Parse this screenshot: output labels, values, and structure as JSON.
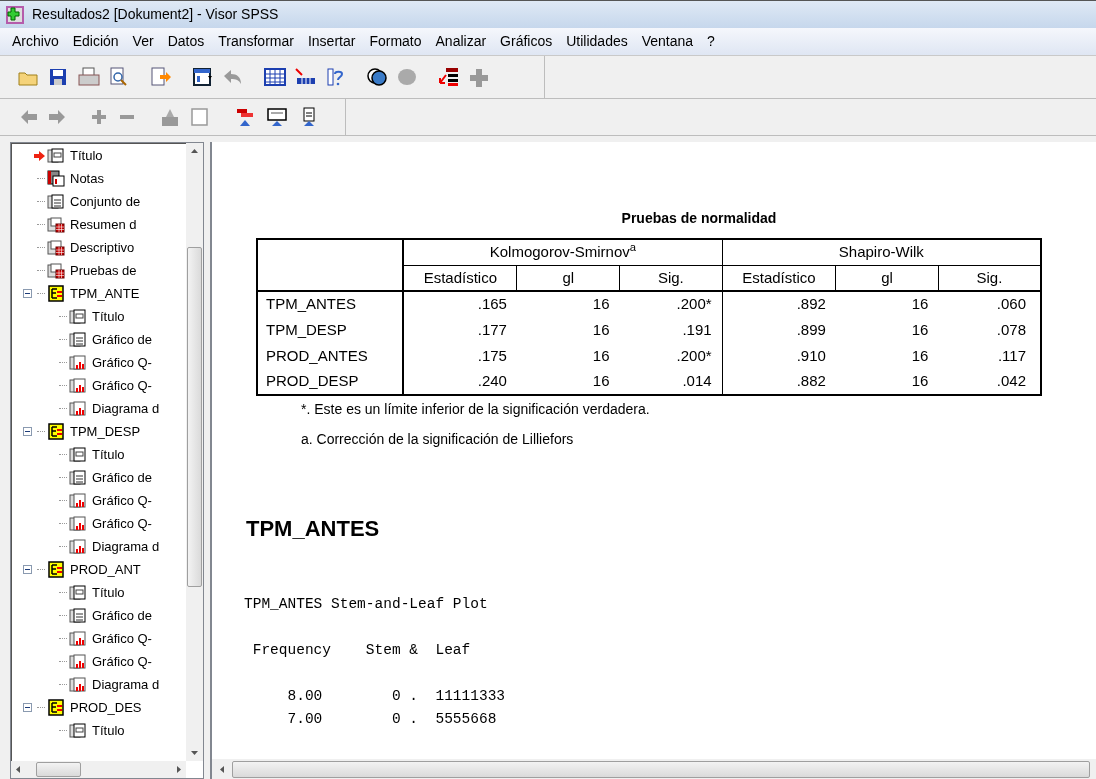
{
  "window": {
    "title": "Resultados2 [Dokument2] - Visor SPSS"
  },
  "menu": [
    "Archivo",
    "Edición",
    "Ver",
    "Datos",
    "Transformar",
    "Insertar",
    "Formato",
    "Analizar",
    "Gráficos",
    "Utilidades",
    "Ventana",
    "?"
  ],
  "tree": [
    {
      "kind": "title",
      "label": "Título",
      "current": true
    },
    {
      "kind": "notes",
      "label": "Notas",
      "current": false
    },
    {
      "kind": "text",
      "label": "Conjunto de",
      "current": false
    },
    {
      "kind": "table",
      "label": "Resumen d",
      "current": false
    },
    {
      "kind": "table",
      "label": "Descriptivo",
      "current": false
    },
    {
      "kind": "table",
      "label": "Pruebas de",
      "current": false
    },
    {
      "kind": "folder",
      "label": "TPM_ANTE",
      "current": false,
      "expanded": true,
      "children": [
        {
          "kind": "title",
          "label": "Título",
          "current": false
        },
        {
          "kind": "text",
          "label": "Gráfico de",
          "current": false
        },
        {
          "kind": "chart",
          "label": "Gráfico Q-",
          "current": false
        },
        {
          "kind": "chart",
          "label": "Gráfico Q-",
          "current": false
        },
        {
          "kind": "chart",
          "label": "Diagrama d",
          "current": false
        }
      ]
    },
    {
      "kind": "folder",
      "label": "TPM_DESP",
      "current": false,
      "expanded": true,
      "children": [
        {
          "kind": "title",
          "label": "Título",
          "current": false
        },
        {
          "kind": "text",
          "label": "Gráfico de",
          "current": false
        },
        {
          "kind": "chart",
          "label": "Gráfico Q-",
          "current": false
        },
        {
          "kind": "chart",
          "label": "Gráfico Q-",
          "current": false
        },
        {
          "kind": "chart",
          "label": "Diagrama d",
          "current": false
        }
      ]
    },
    {
      "kind": "folder",
      "label": "PROD_ANT",
      "current": false,
      "expanded": true,
      "children": [
        {
          "kind": "title",
          "label": "Título",
          "current": false
        },
        {
          "kind": "text",
          "label": "Gráfico de",
          "current": false
        },
        {
          "kind": "chart",
          "label": "Gráfico Q-",
          "current": false
        },
        {
          "kind": "chart",
          "label": "Gráfico Q-",
          "current": false
        },
        {
          "kind": "chart",
          "label": "Diagrama d",
          "current": false
        }
      ]
    },
    {
      "kind": "folder",
      "label": "PROD_DES",
      "current": false,
      "expanded": true,
      "children": [
        {
          "kind": "title",
          "label": "Título",
          "current": false
        }
      ]
    }
  ],
  "table": {
    "title": "Pruebas de normalidad",
    "groups": [
      {
        "label": "Kolmogorov-Smirnov$^{a}$"
      },
      {
        "label": "Shapiro-Wilk"
      }
    ],
    "columns": [
      "Estadístico",
      "gl",
      "Sig.",
      "Estadístico",
      "gl",
      "Sig."
    ],
    "rows": [
      {
        "label": "TPM_ANTES",
        "cells": [
          ".165",
          "16",
          ".200*",
          ".892",
          "16",
          ".060"
        ]
      },
      {
        "label": "TPM_DESP",
        "cells": [
          ".177",
          "16",
          ".191",
          ".899",
          "16",
          ".078"
        ]
      },
      {
        "label": "PROD_ANTES",
        "cells": [
          ".175",
          "16",
          ".200*",
          ".910",
          "16",
          ".117"
        ]
      },
      {
        "label": "PROD_DESP",
        "cells": [
          ".240",
          "16",
          ".014",
          ".882",
          "16",
          ".042"
        ]
      }
    ],
    "footnotes": [
      "*. Este es un límite inferior de la significación verdadera.",
      "a. Corrección de la significación de Lilliefors"
    ]
  },
  "heading": "TPM_ANTES",
  "plot": {
    "title": "TPM_ANTES Stem-and-Leaf Plot",
    "header": " Frequency    Stem &  Leaf",
    "rows": [
      "     8.00        0 .  11111333",
      "     7.00        0 .  5555668"
    ]
  }
}
